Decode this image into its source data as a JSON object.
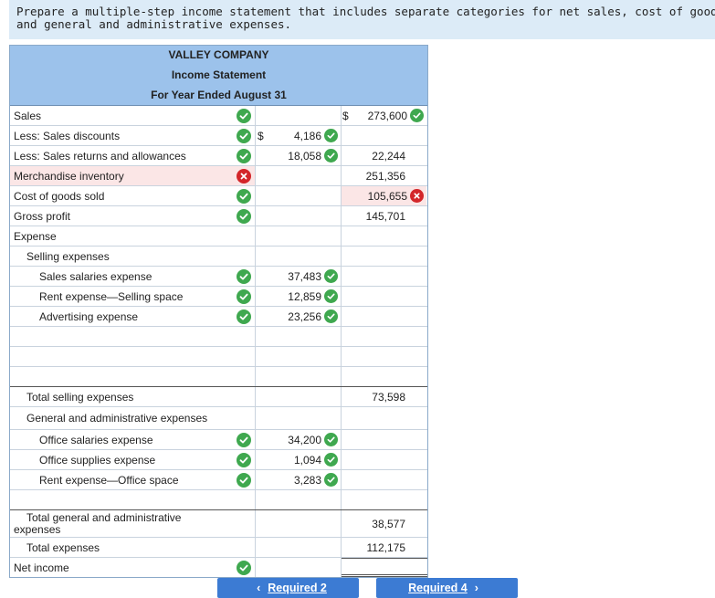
{
  "prompt": {
    "line1": "Prepare a multiple-step income statement that includes separate categories for net sales, cost of goods sold, selling expense",
    "line2": "and general and administrative expenses."
  },
  "statement": {
    "company": "VALLEY COMPANY",
    "title": "Income Statement",
    "period": "For Year Ended August 31"
  },
  "rows": {
    "sales": {
      "label": "Sales",
      "currency": "$",
      "value": "273,600"
    },
    "sales_discounts": {
      "label": "Less: Sales discounts",
      "currency": "$",
      "value": "4,186"
    },
    "returns": {
      "label": "Less: Sales returns and allowances",
      "value": "18,058",
      "net": "22,244"
    },
    "merch": {
      "label": "Merchandise inventory",
      "value": "251,356"
    },
    "cogs": {
      "label": "Cost of goods sold",
      "value": "105,655"
    },
    "gross": {
      "label": "Gross profit",
      "value": "145,701"
    },
    "expense": {
      "label": "Expense"
    },
    "selling": {
      "label": "Selling expenses"
    },
    "sales_salaries": {
      "label": "Sales salaries expense",
      "value": "37,483"
    },
    "rent_selling": {
      "label": "Rent expense—Selling space",
      "value": "12,859"
    },
    "advertising": {
      "label": "Advertising expense",
      "value": "23,256"
    },
    "total_selling": {
      "label": "Total selling expenses",
      "value": "73,598"
    },
    "gen_admin": {
      "label": "General and administrative expenses"
    },
    "office_salaries": {
      "label": "Office salaries expense",
      "value": "34,200"
    },
    "office_supplies": {
      "label": "Office supplies expense",
      "value": "1,094"
    },
    "rent_office": {
      "label": "Rent expense—Office space",
      "value": "3,283"
    },
    "total_ga": {
      "label1": "Total general and administrative",
      "label2": "expenses",
      "value": "38,577"
    },
    "total_exp": {
      "label": "Total expenses",
      "value": "112,175"
    },
    "net_income": {
      "label": "Net income"
    }
  },
  "nav": {
    "prev_label": "Required 2",
    "next_label": "Required 4"
  },
  "colors": {
    "header": "#9cc2eb",
    "correct": "#3fa84f",
    "incorrect": "#d3262a",
    "button": "#3c7bd3"
  }
}
